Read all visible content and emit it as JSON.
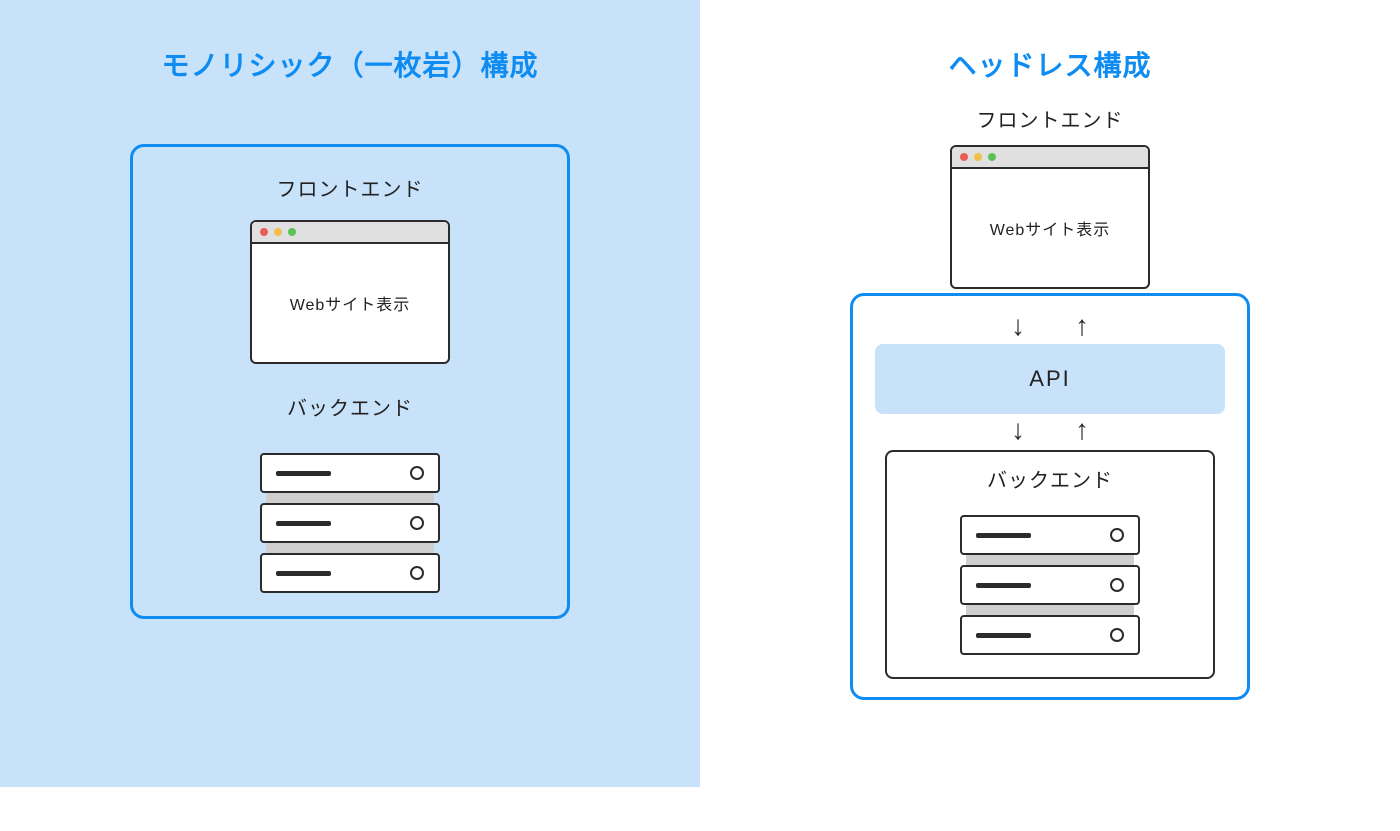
{
  "colors": {
    "accent": "#0F8CF2",
    "leftBg": "#C8E2FA",
    "apiBg": "#C8E2FA"
  },
  "left": {
    "title": "モノリシック（一枚岩）構成",
    "frontend_label": "フロントエンド",
    "browser_text": "Webサイト表示",
    "backend_label": "バックエンド"
  },
  "right": {
    "title": "ヘッドレス構成",
    "frontend_label": "フロントエンド",
    "browser_text": "Webサイト表示",
    "api_label": "API",
    "backend_label": "バックエンド"
  },
  "icons": {
    "traffic_lights": [
      "red",
      "yellow",
      "green"
    ],
    "arrow_down": "↓",
    "arrow_up": "↑"
  }
}
